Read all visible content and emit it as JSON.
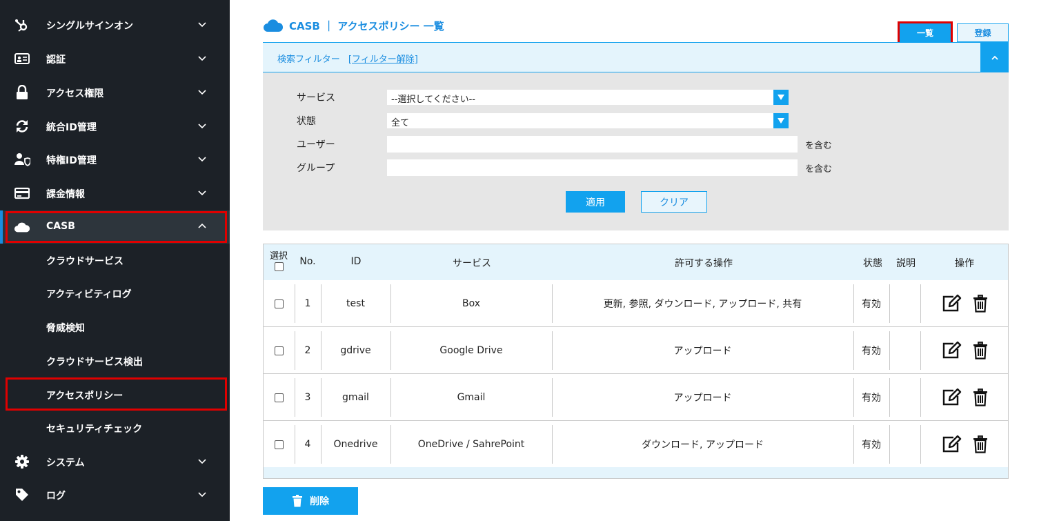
{
  "sidebar": {
    "items": [
      {
        "label": "シングルサインオン",
        "icon": "hubspot-icon"
      },
      {
        "label": "認証",
        "icon": "id-card-icon"
      },
      {
        "label": "アクセス権限",
        "icon": "lock-icon"
      },
      {
        "label": "統合ID管理",
        "icon": "sync-icon"
      },
      {
        "label": "特権ID管理",
        "icon": "user-shield-icon"
      },
      {
        "label": "課金情報",
        "icon": "credit-card-icon"
      },
      {
        "label": "CASB",
        "icon": "cloud-icon"
      }
    ],
    "sub_items": [
      {
        "label": "クラウドサービス"
      },
      {
        "label": "アクティビティログ"
      },
      {
        "label": "脅威検知"
      },
      {
        "label": "クラウドサービス検出"
      },
      {
        "label": "アクセスポリシー"
      },
      {
        "label": "セキュリティチェック"
      }
    ],
    "bottom_items": [
      {
        "label": "システム",
        "icon": "gear-icon"
      },
      {
        "label": "ログ",
        "icon": "tag-icon"
      }
    ]
  },
  "header": {
    "title": "CASB ｜ アクセスポリシー 一覧",
    "tab_list": "一覧",
    "tab_register": "登録"
  },
  "filter": {
    "title": "検索フィルター",
    "clear_link": "[フィルター解除]",
    "service_label": "サービス",
    "service_value": "--選択してください--",
    "status_label": "状態",
    "status_value": "全て",
    "user_label": "ユーザー",
    "group_label": "グループ",
    "contains_suffix": "を含む",
    "apply": "適用",
    "clear": "クリア"
  },
  "table": {
    "headers": {
      "select": "選択",
      "no": "No.",
      "id": "ID",
      "service": "サービス",
      "operations": "許可する操作",
      "status": "状態",
      "description": "説明",
      "actions": "操作"
    },
    "rows": [
      {
        "no": "1",
        "id": "test",
        "service": "Box",
        "operations": "更新, 参照, ダウンロード, アップロード, 共有",
        "status": "有効"
      },
      {
        "no": "2",
        "id": "gdrive",
        "service": "Google Drive",
        "operations": "アップロード",
        "status": "有効"
      },
      {
        "no": "3",
        "id": "gmail",
        "service": "Gmail",
        "operations": "アップロード",
        "status": "有効"
      },
      {
        "no": "4",
        "id": "Onedrive",
        "service": "OneDrive / SahrePoint",
        "operations": "ダウンロード, アップロード",
        "status": "有効"
      }
    ]
  },
  "delete_button": "削除",
  "colors": {
    "accent": "#12a2ee",
    "sidebar_bg": "#1c2127",
    "highlight": "#e00000"
  }
}
